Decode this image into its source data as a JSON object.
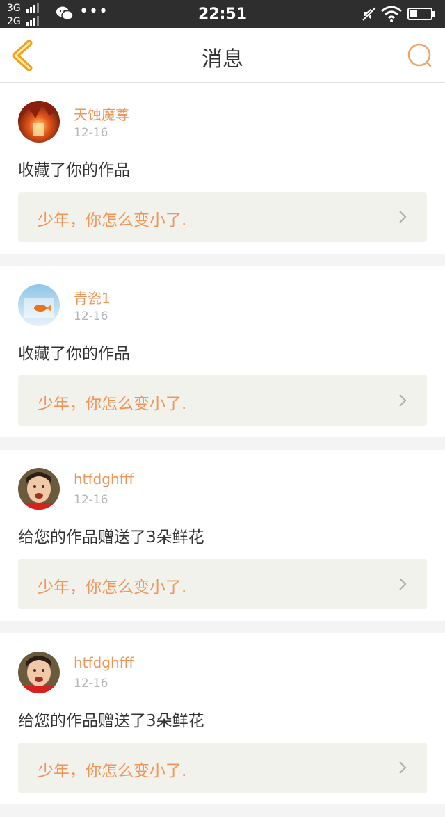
{
  "status_bar": {
    "network_top": "3G",
    "network_bottom": "2G",
    "time": "22:51"
  },
  "nav": {
    "title": "消息",
    "back_icon": "chevron-left-icon",
    "search_icon": "search-icon",
    "accent_color": "#f0a020"
  },
  "colors": {
    "username": "#f0955a",
    "work_title": "#f0955a",
    "work_box_bg": "#f2f2ec"
  },
  "messages": [
    {
      "username": "天蚀魔尊",
      "date": "12-16",
      "action": "收藏了你的作品",
      "work_title": "少年，你怎么变小了."
    },
    {
      "username": "青瓷1",
      "date": "12-16",
      "action": "收藏了你的作品",
      "work_title": "少年，你怎么变小了."
    },
    {
      "username": "htfdghfff",
      "date": "12-16",
      "action": "给您的作品赠送了3朵鲜花",
      "work_title": "少年，你怎么变小了."
    },
    {
      "username": "htfdghfff",
      "date": "12-16",
      "action": "给您的作品赠送了3朵鲜花",
      "work_title": "少年，你怎么变小了."
    }
  ]
}
